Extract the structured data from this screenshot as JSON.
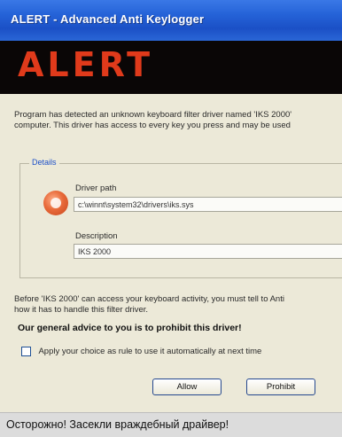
{
  "window": {
    "title": "ALERT - Advanced Anti Keylogger",
    "banner_text": "ALERT"
  },
  "message": {
    "line1": "Program has detected an unknown keyboard filter driver named 'IKS 2000'",
    "line2": "computer. This driver has access to every key you press and may be used"
  },
  "details": {
    "legend": "Details",
    "icon": "driver-gear-icon",
    "driver_path_label": "Driver path",
    "driver_path_value": "c:\\winnt\\system32\\drivers\\iks.sys",
    "description_label": "Description",
    "description_value": "IKS 2000"
  },
  "info": {
    "line1": "Before 'IKS 2000' can access your keyboard activity, you must tell to Anti",
    "line2": "how it has to handle this filter driver."
  },
  "advice": "Our general advice to you is to prohibit this driver!",
  "checkbox": {
    "label": "Apply your choice as rule to use it automatically at next time",
    "checked": false
  },
  "buttons": {
    "allow": "Allow",
    "prohibit": "Prohibit"
  },
  "caption": "Осторожно! Засекли враждебный драйвер!",
  "colors": {
    "titlebar": "#2563d8",
    "banner_bg": "#0a0606",
    "banner_text": "#e03a1b",
    "window_bg": "#ece9d8",
    "legend": "#1d50c8",
    "caption_bg": "#dcdcdc"
  }
}
